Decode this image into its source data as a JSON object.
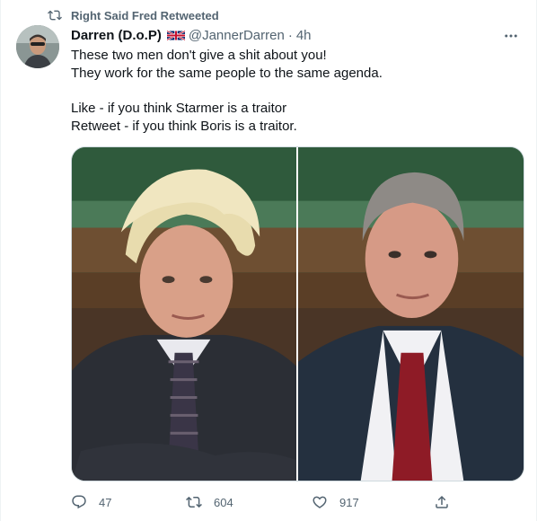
{
  "retweet_context": {
    "label": "Right Said Fred Retweeted",
    "icon": "retweet-icon"
  },
  "author": {
    "display_name": "Darren (D.o.P)",
    "flag": "uk-flag-icon",
    "handle": "@JannerDarren",
    "separator": "·",
    "time": "4h"
  },
  "tweet": {
    "lines": [
      "These two men don't give a shit about you!",
      "They work for the same people to the same agenda.",
      "",
      "Like - if you think Starmer is a traitor",
      "Retweet - if you think Boris is a traitor."
    ]
  },
  "media": {
    "images": [
      {
        "subject": "man-with-blond-hair-dark-suit-photo"
      },
      {
        "subject": "man-with-grey-hair-red-tie-photo"
      }
    ]
  },
  "actions": {
    "reply_count": "47",
    "retweet_count": "604",
    "like_count": "917"
  },
  "colors": {
    "text_primary": "#0f1419",
    "text_secondary": "#536471",
    "border": "#cfd9de"
  }
}
